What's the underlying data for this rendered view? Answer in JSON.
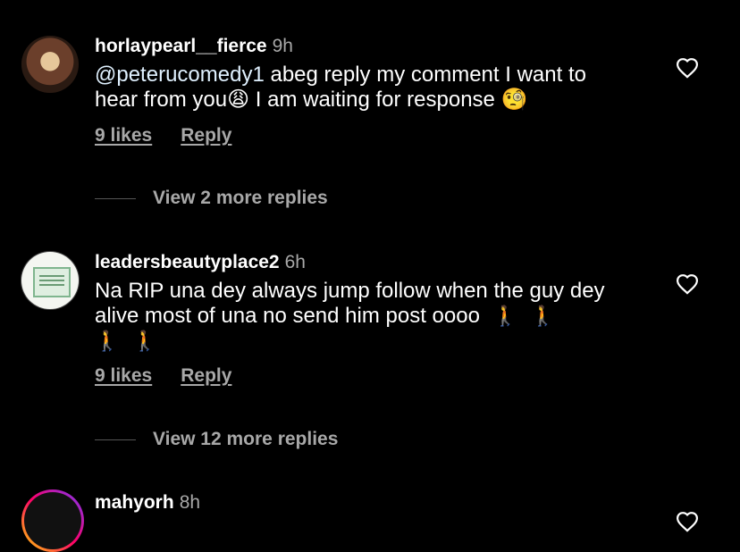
{
  "comments": [
    {
      "username": "horlaypearl__fierce",
      "time": "9h",
      "mention": "@peterucomedy1",
      "text_1": "abeg reply my comment I want to hear from you",
      "emoji_1": "😩",
      "text_2": "I am waiting for response",
      "emoji_2": "🧐",
      "likes": "9 likes",
      "reply": "Reply",
      "more_replies": "View 2 more replies"
    },
    {
      "username": "leadersbeautyplace2",
      "time": "6h",
      "text": "Na RIP una dey always jump follow when the guy dey alive most of una no send him post oooo",
      "emoji": "🚶",
      "likes": "9 likes",
      "reply": "Reply",
      "more_replies": "View 12 more replies"
    },
    {
      "username": "mahyorh",
      "time": "8h"
    }
  ],
  "colors": {
    "background": "#000000",
    "text": "#ffffff",
    "secondary_text": "#a8a8a8"
  }
}
